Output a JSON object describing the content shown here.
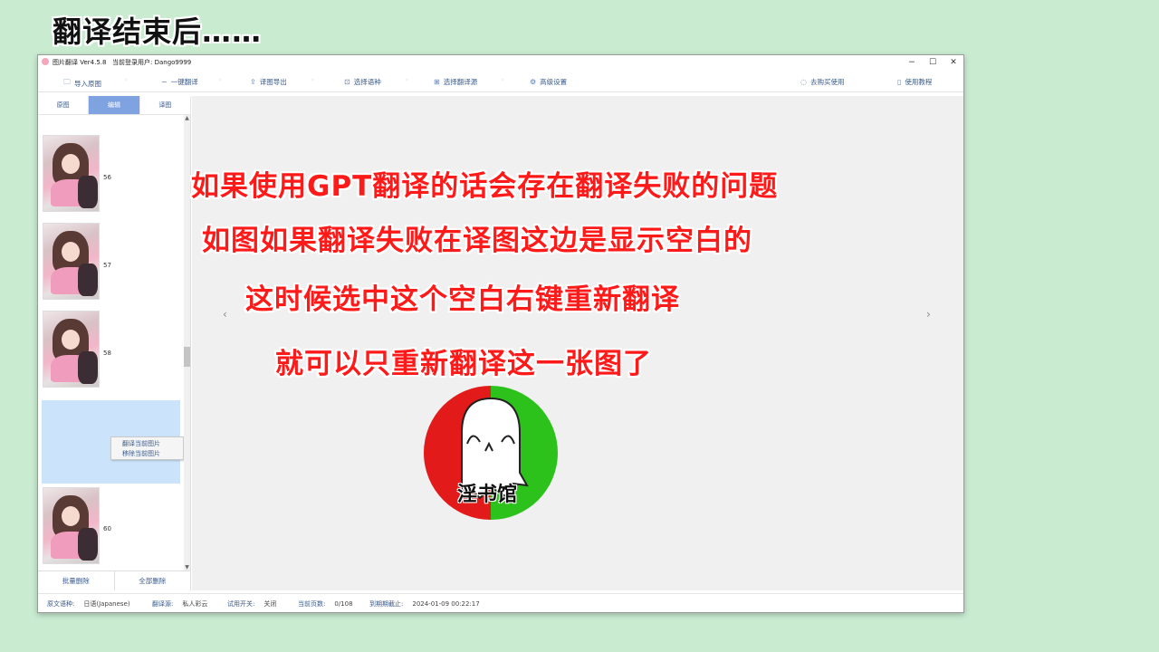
{
  "caption": "翻译结束后……",
  "window": {
    "title": "图片翻译 Ver4.5.8",
    "user": "当前登录用户: Dango9999",
    "controls": {
      "minimize": "−",
      "maximize": "☐",
      "close": "✕"
    }
  },
  "toolbar": {
    "import": "导入原图",
    "one_click": "一键翻译",
    "export": "译图导出",
    "language": "选择语种",
    "source": "选择翻译源",
    "advanced": "高级设置",
    "buy": "去购买使用",
    "tutorial": "使用教程"
  },
  "tabs": [
    "原图",
    "编辑",
    "译图"
  ],
  "thumbnails": [
    "56",
    "57",
    "58",
    "60"
  ],
  "context_menu": [
    "翻译当前图片",
    "移除当前图片"
  ],
  "bottom_buttons": {
    "batch_delete": "批量删除",
    "delete_all": "全部删除"
  },
  "annotations": [
    "如果使用GPT翻译的话会存在翻译失败的问题",
    "如图如果翻译失败在译图这边是显示空白的",
    "这时候选中这个空白右键重新翻译",
    "就可以只重新翻译这一张图了"
  ],
  "logo_text": "淫书馆",
  "status": {
    "src_lang_label": "原文语种:",
    "src_lang_value": "日语(Japanese)",
    "trans_src_label": "翻译源:",
    "trans_src_value": "私人彩云",
    "trial_label": "试用开关:",
    "trial_value": "关闭",
    "pages_label": "当前页数:",
    "pages_value": "0/108",
    "expiry_label": "到期期截止:",
    "expiry_value": "2024-01-09 00:22:17"
  },
  "colors": {
    "background": "#c9ecd1",
    "accent": "#7fa3e0",
    "annotation": "#ff1a1a",
    "logo_red": "#e31a1a",
    "logo_green": "#2dc21b"
  }
}
